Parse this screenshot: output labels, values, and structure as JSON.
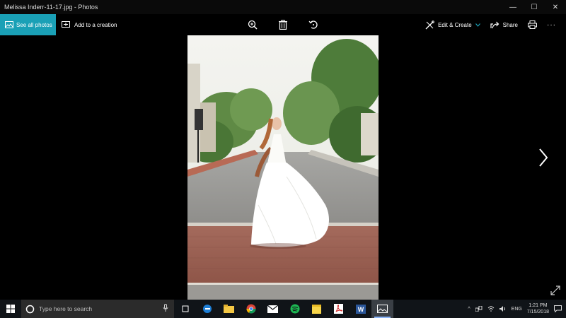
{
  "window": {
    "title": "Melissa Inderr-11-17.jpg - Photos",
    "minimize": "—",
    "maximize": "☐",
    "close": "✕"
  },
  "toolbar": {
    "see_all_photos": "See all photos",
    "add_to_creation": "Add to a creation",
    "edit_create": "Edit & Create",
    "share": "Share",
    "more": "···"
  },
  "taskbar": {
    "search_placeholder": "Type here to search",
    "apps": [
      "task-view",
      "edge",
      "file-explorer",
      "chrome",
      "mail",
      "spotify",
      "sticky-notes",
      "acrobat",
      "word",
      "photos"
    ],
    "tray_lang": "ENG",
    "time": "1:21 PM",
    "date": "7/15/2018"
  },
  "colors": {
    "accent": "#1aa0b6",
    "background": "#000000",
    "taskbar": "#101418"
  }
}
